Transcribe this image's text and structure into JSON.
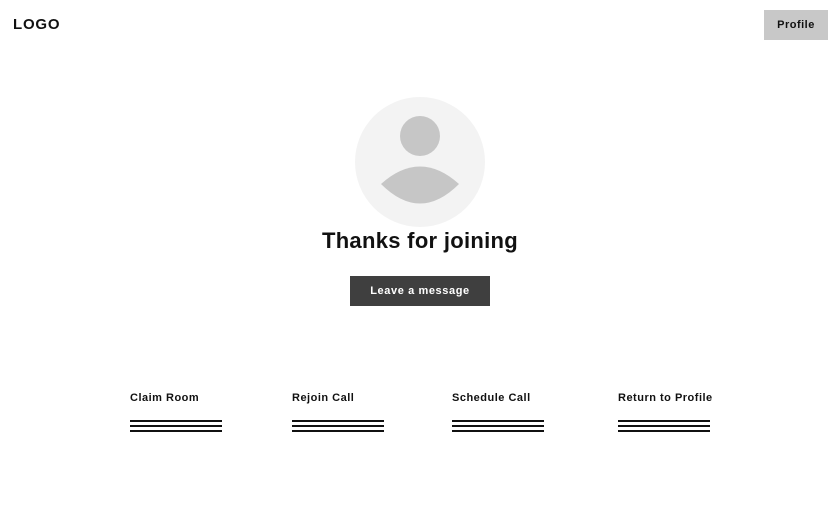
{
  "header": {
    "logo_text": "LOGO",
    "profile_label": "Profile"
  },
  "avatar": {
    "icon": "user-silhouette-icon"
  },
  "main": {
    "title": "Thanks for joining",
    "message_button_label": "Leave a message"
  },
  "actions": [
    {
      "label": "Claim Room"
    },
    {
      "label": "Rejoin Call"
    },
    {
      "label": "Schedule Call"
    },
    {
      "label": "Return to Profile"
    }
  ],
  "colors": {
    "background": "#ffffff",
    "profile_button": "#c8c8c8",
    "avatar_bg": "#f3f3f3",
    "avatar_figure": "#c6c6c6",
    "message_button": "#3f3f3f",
    "text": "#111111"
  }
}
